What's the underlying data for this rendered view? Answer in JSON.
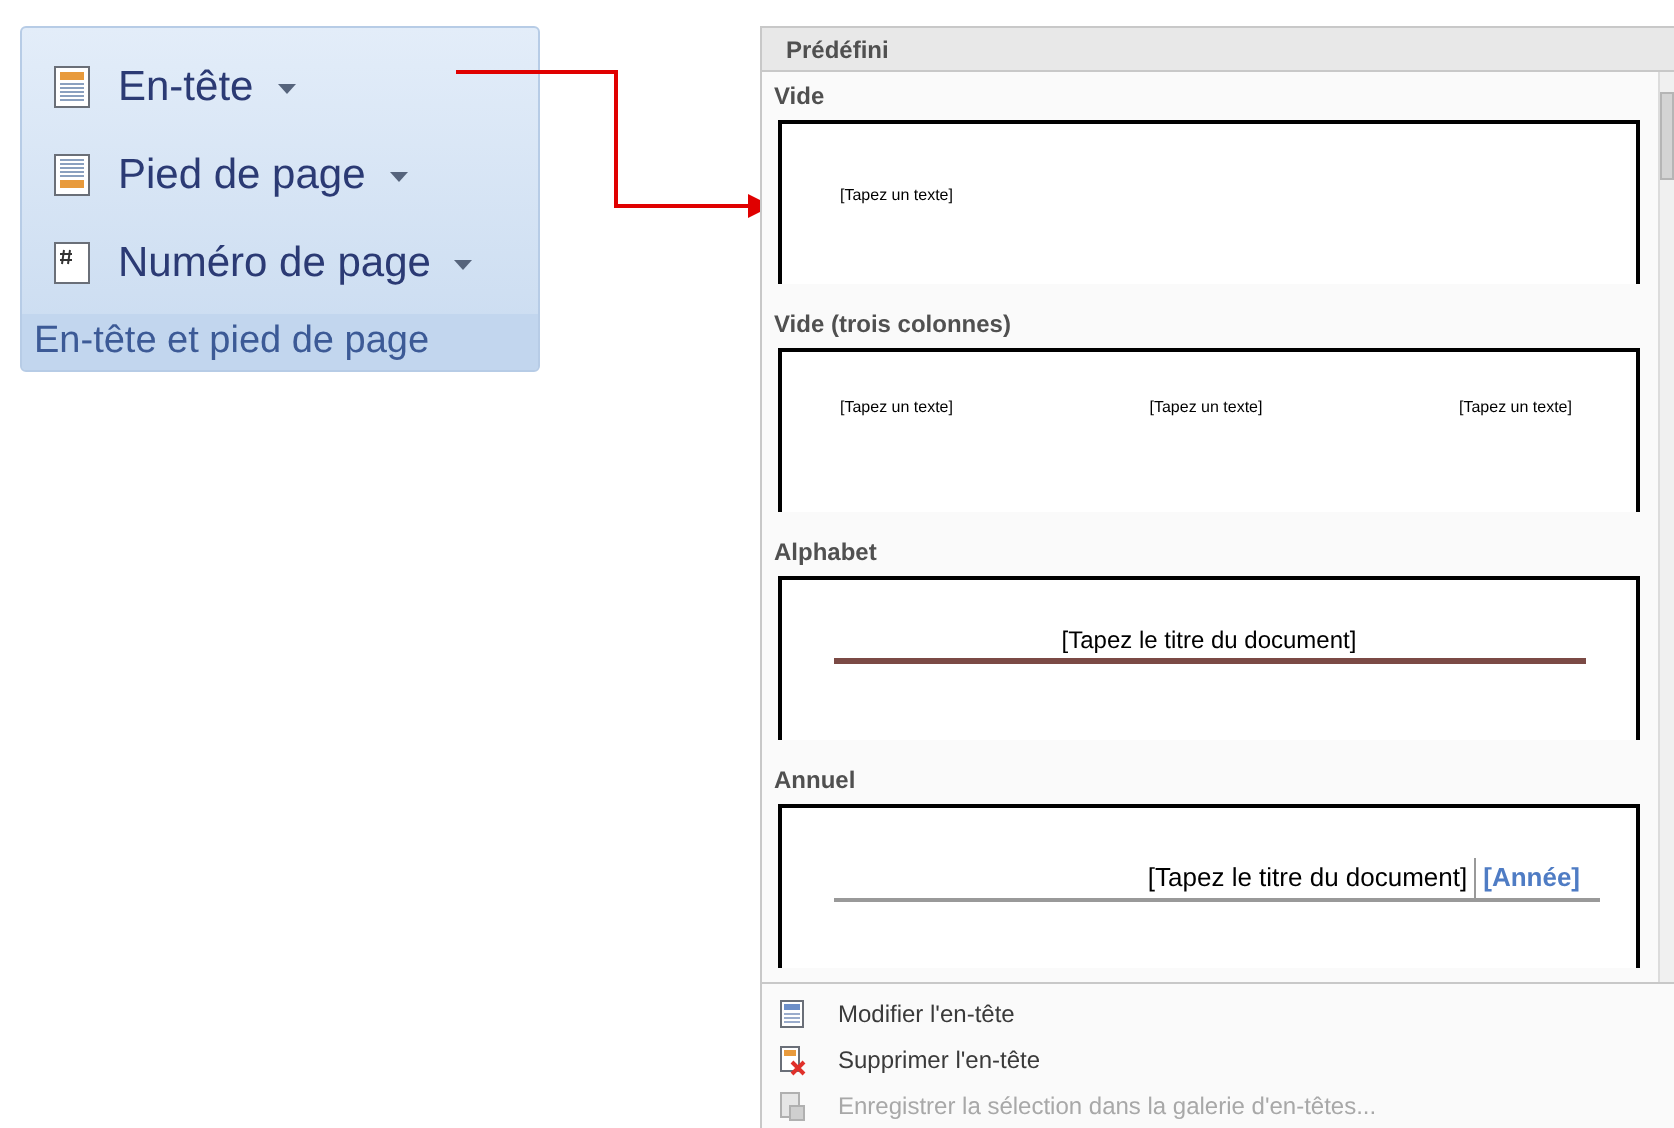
{
  "ribbon_group": {
    "items": [
      {
        "label": "En-tête",
        "kind": "header"
      },
      {
        "label": "Pied de page",
        "kind": "footer"
      },
      {
        "label": "Numéro de page",
        "kind": "page_number"
      }
    ],
    "caption": "En-tête et pied de page"
  },
  "gallery": {
    "heading": "Prédéfini",
    "templates": [
      {
        "name": "Vide",
        "kind": "single",
        "texts": [
          "[Tapez un texte]"
        ]
      },
      {
        "name": "Vide (trois colonnes)",
        "kind": "three_columns",
        "texts": [
          "[Tapez un texte]",
          "[Tapez un texte]",
          "[Tapez un texte]"
        ]
      },
      {
        "name": "Alphabet",
        "kind": "title_rule",
        "texts": [
          "[Tapez le titre du document]"
        ]
      },
      {
        "name": "Annuel",
        "kind": "title_year",
        "texts": [
          "[Tapez le titre du document]",
          "[Année]"
        ]
      }
    ]
  },
  "menu": [
    {
      "label": "Modifier l'en-tête",
      "kind": "edit",
      "disabled": false
    },
    {
      "label": "Supprimer l'en-tête",
      "kind": "remove",
      "disabled": false
    },
    {
      "label": "Enregistrer la sélection dans la galerie d'en-têtes...",
      "kind": "save",
      "disabled": true
    }
  ]
}
